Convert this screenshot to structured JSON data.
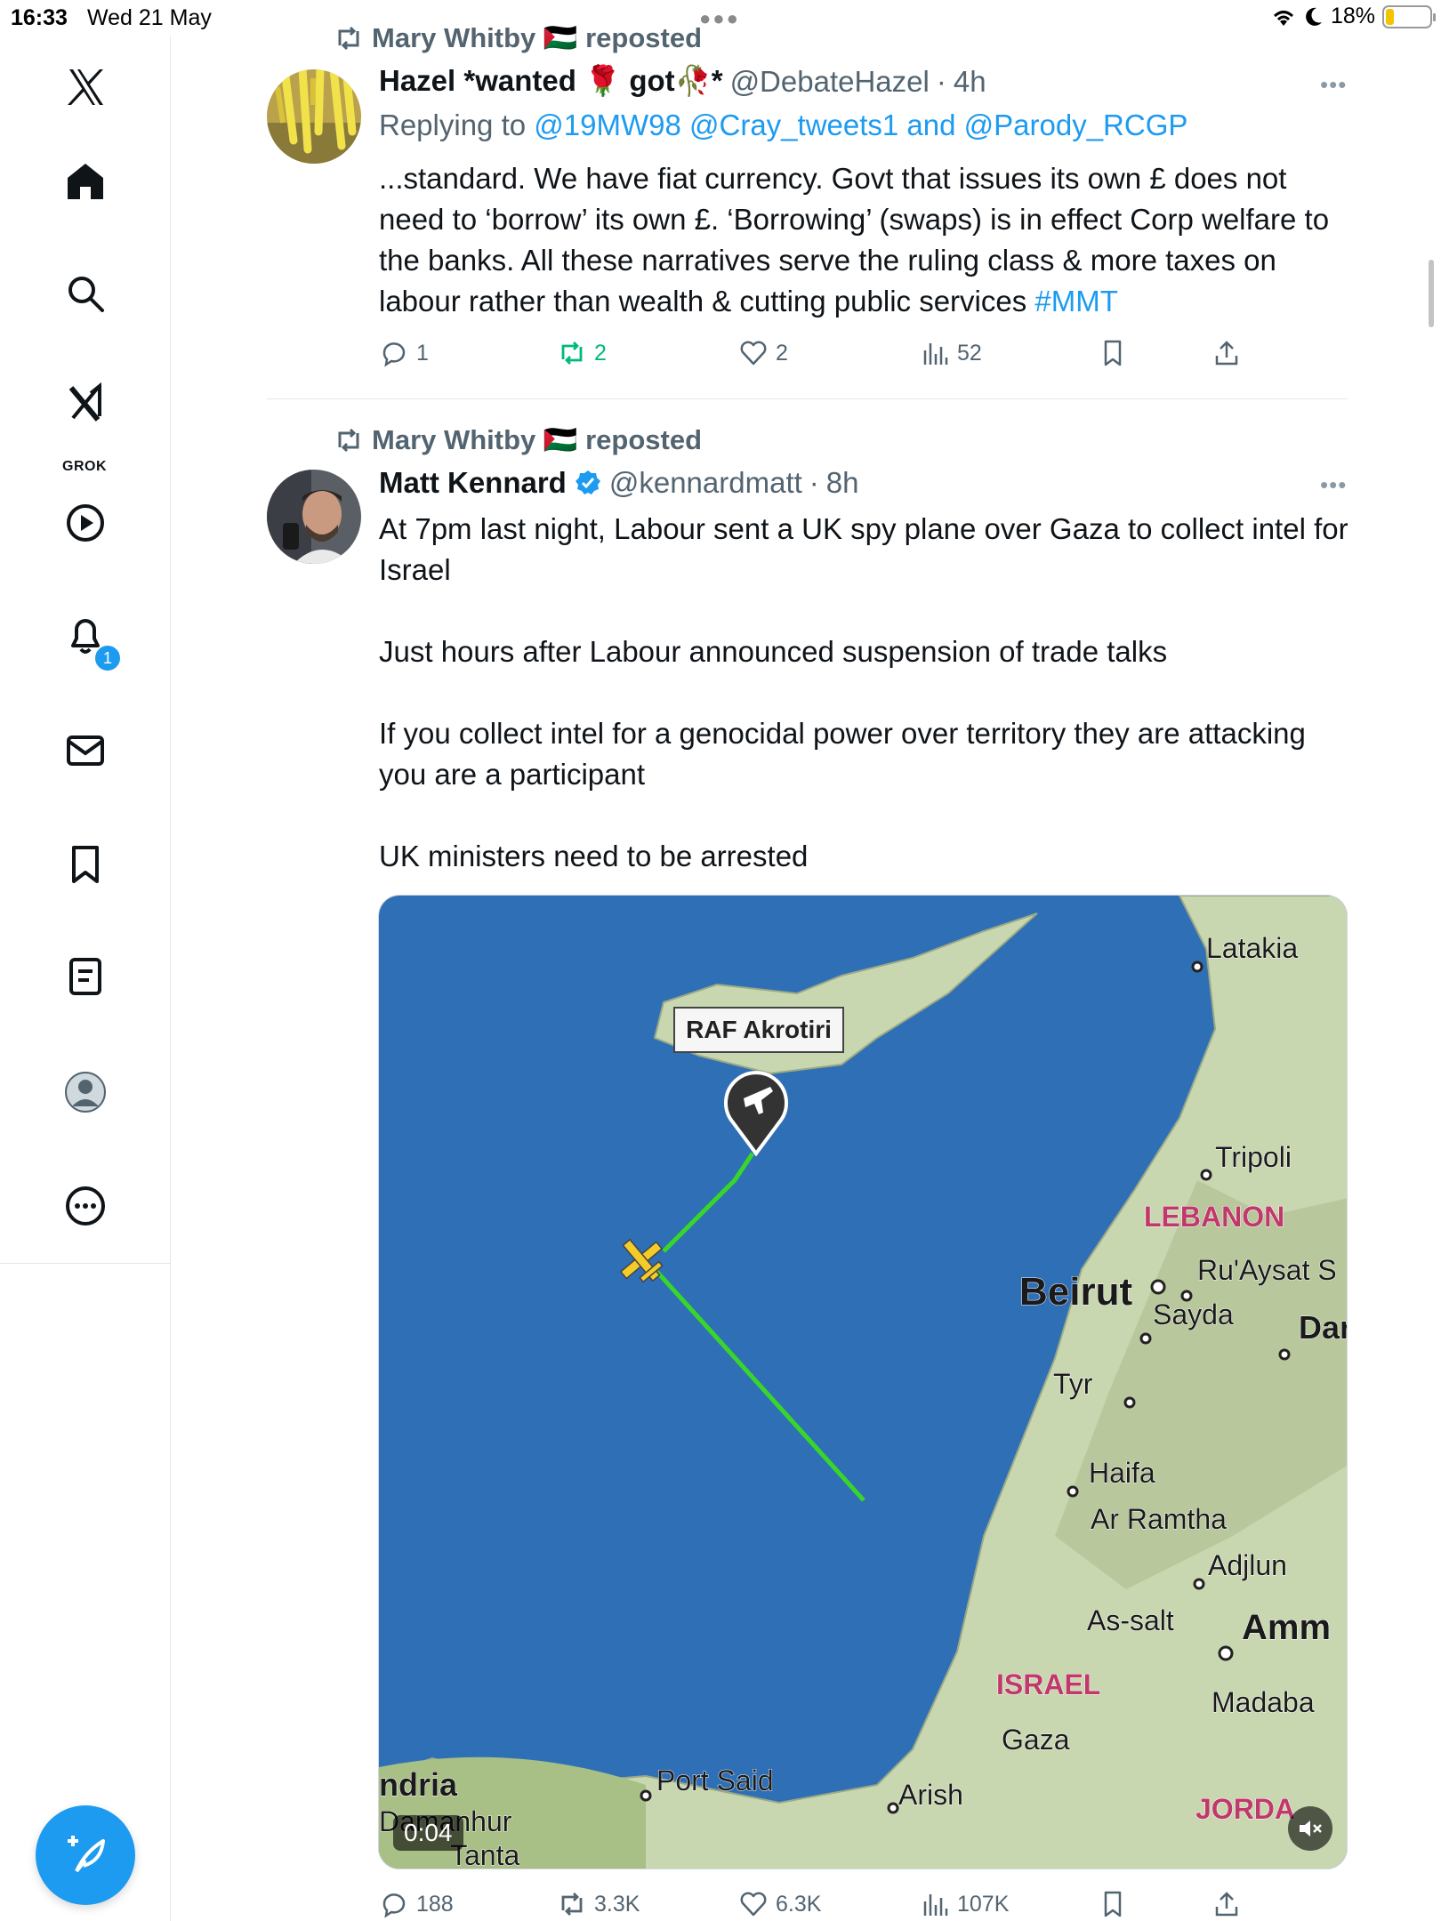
{
  "status_bar": {
    "time": "16:33",
    "date": "Wed 21 May",
    "battery": "18%",
    "battery_level": 0.18
  },
  "sidebar": {
    "items": [
      {
        "icon": "x-logo-icon"
      },
      {
        "icon": "home-icon"
      },
      {
        "icon": "search-icon"
      },
      {
        "icon": "grok-icon",
        "label": "GROK"
      },
      {
        "icon": "play-icon"
      },
      {
        "icon": "bell-icon",
        "badge": "1"
      },
      {
        "icon": "mail-icon"
      },
      {
        "icon": "bookmark-icon"
      },
      {
        "icon": "list-icon"
      },
      {
        "icon": "profile-icon"
      },
      {
        "icon": "more-icon"
      }
    ],
    "compose_icon": "feather-plus-icon"
  },
  "tweets": [
    {
      "repost_by": "Mary Whitby 🇵🇸 reposted",
      "display_name": "Hazel *wanted 🌹 got🥀*",
      "handle": "@DebateHazel",
      "sep": "·",
      "age": "4h",
      "replying_prefix": "Replying to",
      "replying_to": "@19MW98 @Cray_tweets1 and @Parody_RCGP",
      "text": "...standard.  We have fiat currency.  Govt that issues its own £ does not need to ‘borrow’ its own £.  ‘Borrowing’ (swaps) is  in effect Corp welfare to the banks. All these narratives serve the ruling class & more taxes on labour rather than wealth & cutting public services",
      "hashtag": "#MMT",
      "replies": "1",
      "reposts": "2",
      "likes": "2",
      "views": "52"
    },
    {
      "repost_by": "Mary Whitby 🇵🇸 reposted",
      "display_name": "Matt Kennard",
      "verified": true,
      "handle": "@kennardmatt",
      "sep": "·",
      "age": "8h",
      "paragraphs": [
        "At 7pm last night, Labour sent a UK spy plane over Gaza to collect intel for Israel",
        "Just hours after Labour announced suspension of trade talks",
        "If you collect intel for a genocidal power over territory they are attacking you are a participant",
        "UK ministers need to be arrested"
      ],
      "video": {
        "time": "0:04",
        "map_labels": {
          "akrotiri": "RAF Akrotiri",
          "latakia": "Latakia",
          "tripoli": "Tripoli",
          "lebanon": "LEBANON",
          "beirut": "Beirut",
          "ruaysat": "Ru'Aysat S",
          "sayda": "Sayda",
          "dar": "Dar",
          "tyr": "Tyr",
          "haifa": "Haifa",
          "ramtha": "Ar Ramtha",
          "adjlun": "Adjlun",
          "assalt": "As-salt",
          "amman": "Amm",
          "israel": "ISRAEL",
          "madaba": "Madaba",
          "gaza": "Gaza",
          "arish": "Arish",
          "portsaid": "Port Said",
          "jordan": "JORDA",
          "alexandria": "ndria",
          "damanhur": "Damanhur",
          "tanta": "Tanta"
        }
      },
      "replies": "188",
      "reposts": "3.3K",
      "likes": "6.3K",
      "views": "107K"
    }
  ],
  "colors": {
    "accent": "#1d9bf0",
    "repost_green": "#00ba7c",
    "muted": "#536471",
    "sea": "#2f6fb6",
    "land": "#c9d7b0",
    "flight_path": "#39d62a",
    "plane": "#f3cc2a"
  }
}
